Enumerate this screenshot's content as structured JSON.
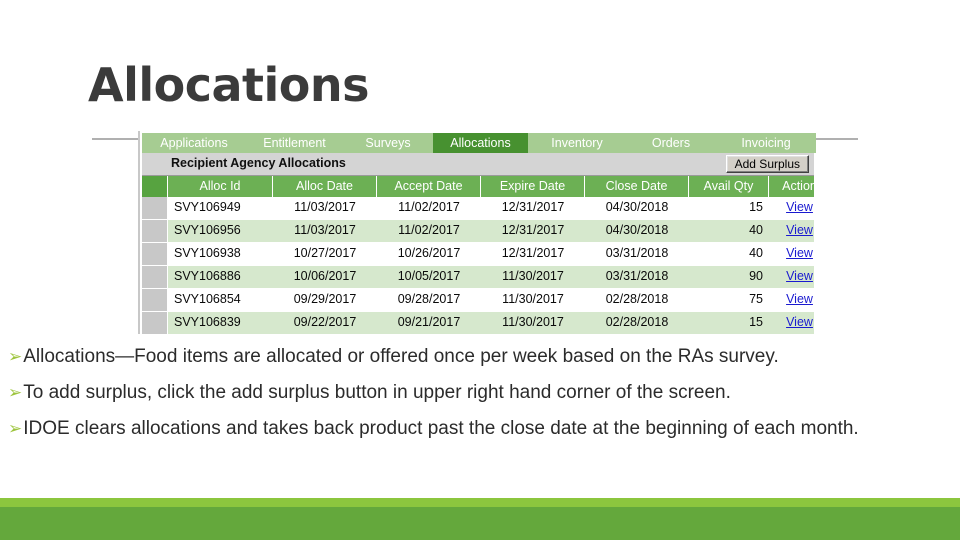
{
  "slide": {
    "title": "Allocations"
  },
  "app": {
    "tabs": [
      {
        "label": "Applications",
        "active": false,
        "width": 104
      },
      {
        "label": "Entitlement",
        "active": false,
        "width": 97
      },
      {
        "label": "Surveys",
        "active": false,
        "width": 90
      },
      {
        "label": "Allocations",
        "active": true,
        "width": 95
      },
      {
        "label": "Inventory",
        "active": false,
        "width": 98
      },
      {
        "label": "Orders",
        "active": false,
        "width": 90
      },
      {
        "label": "Invoicing",
        "active": false,
        "width": 100
      }
    ],
    "section": {
      "title": "Recipient Agency Allocations",
      "add_surplus_label": "Add Surplus"
    },
    "grid": {
      "columns": [
        "Alloc Id",
        "Alloc Date",
        "Accept Date",
        "Expire Date",
        "Close Date",
        "Avail Qty",
        "Action"
      ],
      "action_label": "View",
      "rows": [
        {
          "alloc_id": "SVY106949",
          "alloc_date": "11/03/2017",
          "accept_date": "11/02/2017",
          "expire_date": "12/31/2017",
          "close_date": "04/30/2018",
          "avail_qty": "15",
          "action": "View"
        },
        {
          "alloc_id": "SVY106956",
          "alloc_date": "11/03/2017",
          "accept_date": "11/02/2017",
          "expire_date": "12/31/2017",
          "close_date": "04/30/2018",
          "avail_qty": "40",
          "action": "View"
        },
        {
          "alloc_id": "SVY106938",
          "alloc_date": "10/27/2017",
          "accept_date": "10/26/2017",
          "expire_date": "12/31/2017",
          "close_date": "03/31/2018",
          "avail_qty": "40",
          "action": "View"
        },
        {
          "alloc_id": "SVY106886",
          "alloc_date": "10/06/2017",
          "accept_date": "10/05/2017",
          "expire_date": "11/30/2017",
          "close_date": "03/31/2018",
          "avail_qty": "90",
          "action": "View"
        },
        {
          "alloc_id": "SVY106854",
          "alloc_date": "09/29/2017",
          "accept_date": "09/28/2017",
          "expire_date": "11/30/2017",
          "close_date": "02/28/2018",
          "avail_qty": "75",
          "action": "View"
        },
        {
          "alloc_id": "SVY106839",
          "alloc_date": "09/22/2017",
          "accept_date": "09/21/2017",
          "expire_date": "11/30/2017",
          "close_date": "02/28/2018",
          "avail_qty": "15",
          "action": "View"
        }
      ]
    }
  },
  "bullets": [
    {
      "marker": "➢",
      "text": "Allocations—Food items are allocated or offered once per week based on the RAs survey."
    },
    {
      "marker": "➢",
      "text": "To add surplus, click the add surplus button in upper right hand corner of the screen."
    },
    {
      "marker": "➢",
      "text": "IDOE clears allocations and takes back product past the close date at the beginning of each month."
    }
  ],
  "colors": {
    "tab_inactive": "#a6cc92",
    "tab_active": "#479130",
    "grid_header": "#6cb054",
    "row_alt": "#d6e8cd",
    "selector_col": "#c8c8c8",
    "link": "#1a1ad0",
    "bullet_marker": "#9dc43d",
    "bottom_stripe": "#8cc63e",
    "bottom_band": "#64a83c",
    "title_text": "#3b3b3b"
  }
}
